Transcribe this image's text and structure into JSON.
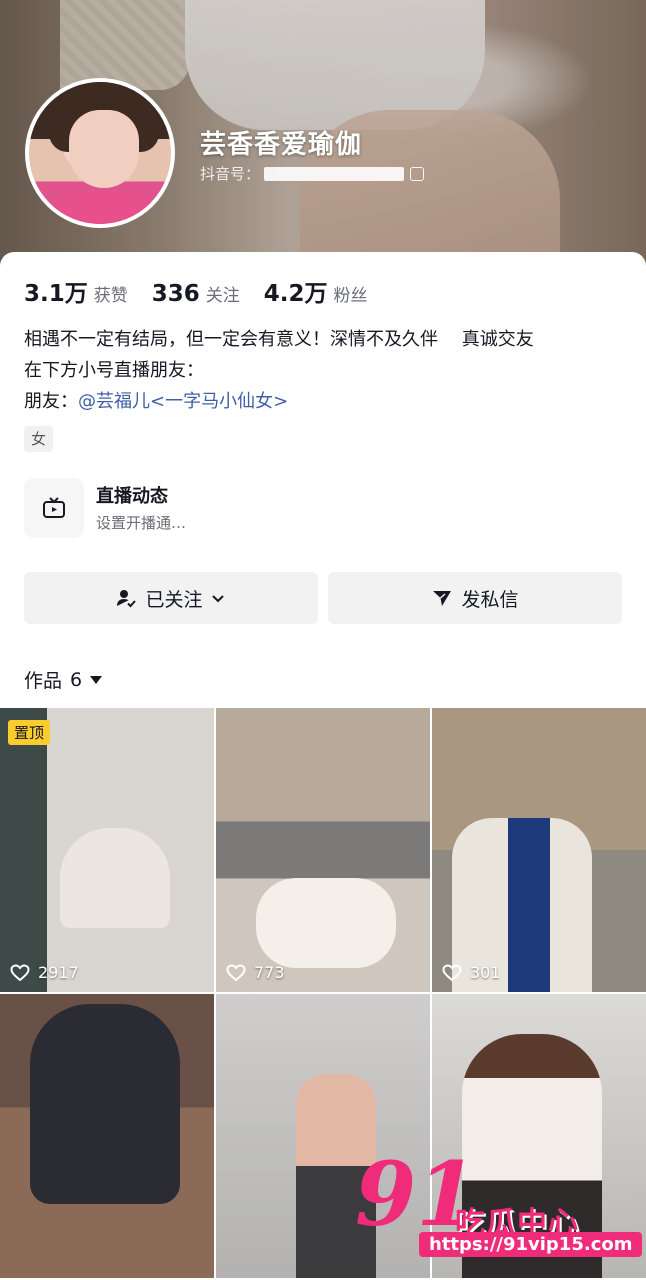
{
  "profile": {
    "nickname": "芸香香爱瑜伽",
    "douyin_id_label": "抖音号："
  },
  "stats": [
    {
      "num": "3.1万",
      "label": "获赞"
    },
    {
      "num": "336",
      "label": "关注"
    },
    {
      "num": "4.2万",
      "label": "粉丝"
    }
  ],
  "bio": {
    "line1": "相遇不一定有结局，但一定会有意义！深情不及久伴　 真诚交友",
    "line2": "在下方小号直播朋友：",
    "line3_prefix": "朋友：",
    "line3_mention": "@芸福儿<一字马小仙女>"
  },
  "tag": "女",
  "live": {
    "title": "直播动态",
    "subtitle": "设置开播通…"
  },
  "buttons": {
    "follow": "已关注",
    "message": "发私信"
  },
  "works": {
    "label": "作品",
    "count": "6"
  },
  "grid": [
    {
      "pinned": "置顶",
      "likes": "2917"
    },
    {
      "likes": "773"
    },
    {
      "likes": "301"
    },
    {},
    {},
    {}
  ],
  "watermark": {
    "big": "91",
    "cn": "吃瓜中心",
    "url": "https://91vip15.com"
  },
  "colors": {
    "accent_watermark": "#ef2b7a",
    "mention": "#3f5fa5",
    "pin_badge": "#facc2e"
  }
}
